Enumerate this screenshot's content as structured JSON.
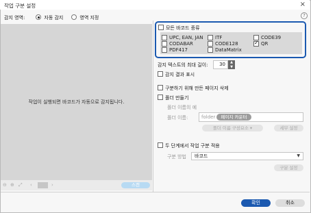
{
  "window": {
    "title": "작업 구분 설정"
  },
  "detection_area": {
    "label": "감지 영역:",
    "options": [
      {
        "label": "자동 감지",
        "selected": true
      },
      {
        "label": "영역 지정",
        "selected": false
      }
    ]
  },
  "preview": {
    "message": "작업이 실행되면 바코드가 자동으로 감지됩니다."
  },
  "toolbar": {
    "scan_label": "스캔"
  },
  "barcode": {
    "all_types_label": "모든 바코드 종류",
    "all_types_checked": false,
    "types": [
      {
        "label": "UPC, EAN, JAN",
        "checked": false
      },
      {
        "label": "ITF",
        "checked": false
      },
      {
        "label": "CODE39",
        "checked": false
      },
      {
        "label": "CODABAR",
        "checked": false
      },
      {
        "label": "CODE128",
        "checked": false
      },
      {
        "label": "QR",
        "checked": true
      },
      {
        "label": "PDF417",
        "checked": false
      },
      {
        "label": "DataMatrix",
        "checked": false
      }
    ]
  },
  "max_length": {
    "label": "감지 텍스트의 최대 길이:",
    "value": "30"
  },
  "options": {
    "show_result": "감지 결과 표시",
    "delete_separator": "구분하기 위해 만든 페이지 삭제",
    "create_folder": "폴더 만들기",
    "folder_example": "폴더 이름의 예",
    "folder_name_label": "폴더 이름:",
    "folder_prefix": "folder",
    "folder_tag": "페이지 카운터",
    "folder_config_button": "폴더 이름 구성요소 ▾",
    "detail_button": "세부 설정"
  },
  "two_stage": {
    "label": "두 단계에서 작업 구분 적용",
    "method_label": "구분 방법",
    "method_value": "바코드",
    "settings_button": "구분 설정"
  },
  "footer": {
    "ok_label": "확인",
    "cancel_label": "취소"
  },
  "colors": {
    "accent": "#1b59b0",
    "scan_button": "#b7daf3",
    "preview_bg": "#d6d6d6"
  }
}
